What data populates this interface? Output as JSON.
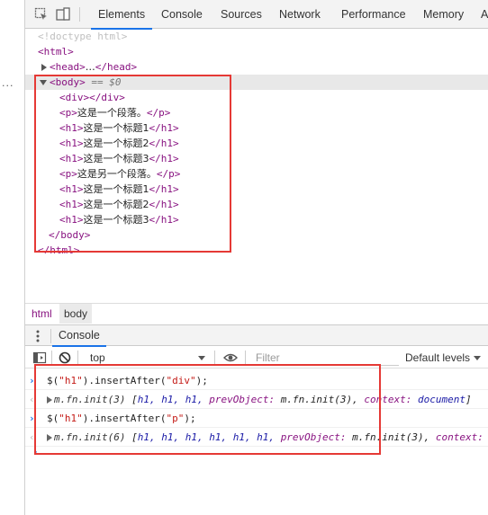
{
  "tabs": {
    "elements": "Elements",
    "console": "Console",
    "sources": "Sources",
    "network": "Network",
    "performance": "Performance",
    "memory": "Memory",
    "more": "A"
  },
  "dom_tree": {
    "doctype": "<!doctype html>",
    "html_open": "<html>",
    "head_open": "<head>",
    "head_ellipsis": "…",
    "head_close": "</head>",
    "body_open": "<body>",
    "body_eq": "==",
    "body_selected_var": "$0",
    "div_open": "<div>",
    "div_close": "</div>",
    "p_open": "<p>",
    "p_close": "</p>",
    "h1_open": "<h1>",
    "h1_close": "</h1>",
    "p1_text": "这是一个段落。",
    "h1_1_text": "这是一个标题1",
    "h1_2_text": "这是一个标题2",
    "h1_3_text": "这是一个标题3",
    "p2_text": "这是另一个段落。",
    "h1_4_text": "这是一个标题1",
    "h1_5_text": "这是一个标题2",
    "h1_6_text": "这是一个标题3",
    "body_close": "</body>",
    "html_close": "</html>",
    "dots": "..."
  },
  "breadcrumb": {
    "html": "html",
    "body": "body"
  },
  "drawer": {
    "console_tab": "Console"
  },
  "console_toolbar": {
    "context": "top",
    "filter_placeholder": "Filter",
    "levels": "Default levels"
  },
  "console": {
    "line1": {
      "prefix": "$(",
      "sel": "\"h1\"",
      "mid": ").insertAfter(",
      "arg": "\"div\"",
      "suffix": ");"
    },
    "result1": {
      "name": "m.fn.init(3)",
      "open": " [",
      "items": "h1, h1, h1, ",
      "key1": "prevObject:",
      "val1": " m.fn.init(3), ",
      "key2": "context:",
      "val2": " document",
      "close": "]"
    },
    "line2": {
      "prefix": "$(",
      "sel": "\"h1\"",
      "mid": ").insertAfter(",
      "arg": "\"p\"",
      "suffix": ");"
    },
    "result2": {
      "name": "m.fn.init(6)",
      "open": " [",
      "items": "h1, h1, h1, h1, h1, h1, ",
      "key1": "prevObject:",
      "val1": " m.fn.init(3), ",
      "key2": "context:",
      "val2": ""
    }
  },
  "colors": {
    "accent": "#1a73e8",
    "tag": "#881280",
    "highlight_box": "#e53935",
    "string": "#c41a16"
  }
}
